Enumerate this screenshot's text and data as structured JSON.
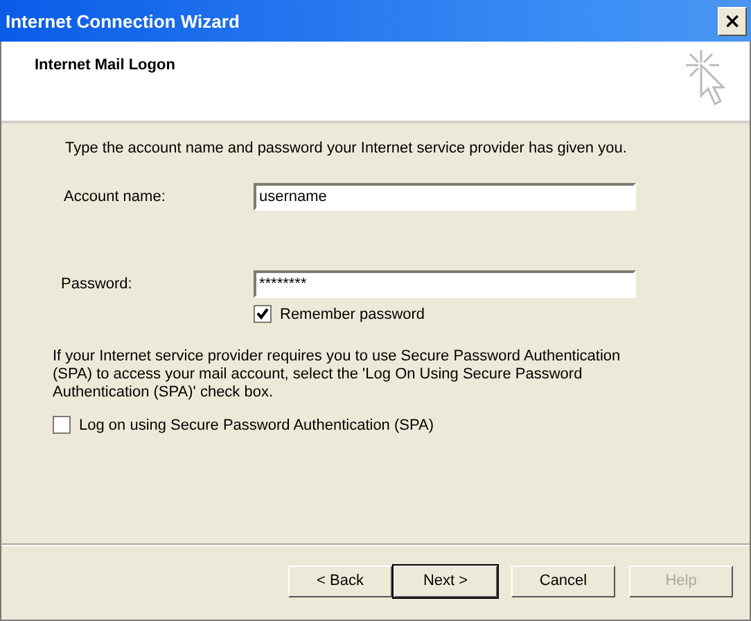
{
  "window": {
    "title": "Internet Connection Wizard",
    "close_label": "×"
  },
  "header": {
    "title": "Internet Mail Logon"
  },
  "intro": "Type the account name and password your Internet service provider has given you.",
  "fields": [
    {
      "label": "Account name:",
      "value": "username"
    },
    {
      "label": "Password:",
      "value": "********"
    }
  ],
  "remember": {
    "label": "Remember password",
    "checked": true
  },
  "spa_note": "If your Internet service provider requires you to use Secure Password Authentication (SPA) to access your mail account, select the 'Log On Using Secure Password Authentication (SPA)' check box.",
  "spa": {
    "label": "Log on using Secure Password Authentication (SPA)",
    "checked": false
  },
  "buttons": [
    {
      "label": "< Back",
      "default": false,
      "disabled": false
    },
    {
      "label": "Next >",
      "default": true,
      "disabled": false
    },
    {
      "label": "Cancel",
      "default": false,
      "disabled": false
    },
    {
      "label": "Help",
      "default": false,
      "disabled": true
    }
  ]
}
